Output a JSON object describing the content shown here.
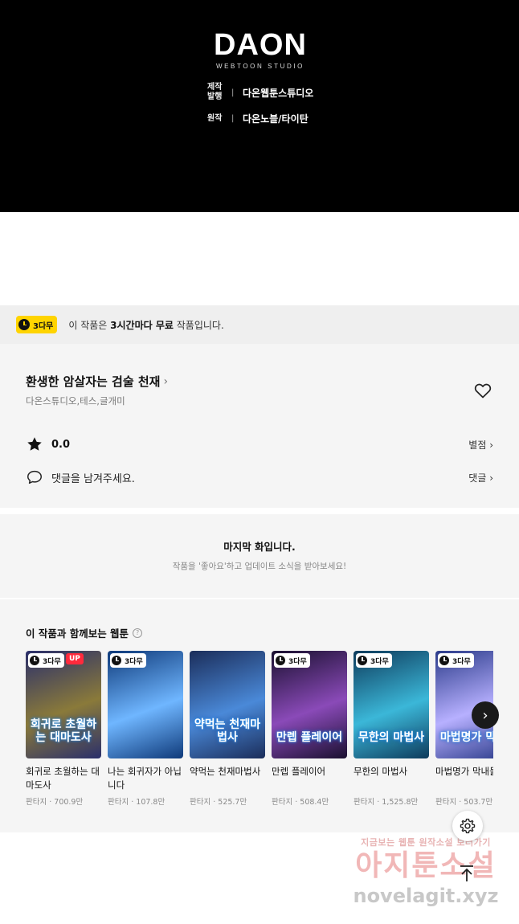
{
  "banner": {
    "logo_main": "DAON",
    "logo_sub": "WEBTOON STUDIO",
    "credits": [
      {
        "role": "제작 발행",
        "name": "다온웹툰스튜디오"
      },
      {
        "role": "원작",
        "name": "다온노블/타이탄"
      }
    ]
  },
  "free_notice": {
    "badge": "3다무",
    "text_prefix": "이 작품은 ",
    "text_bold": "3시간마다 무료",
    "text_suffix": " 작품입니다."
  },
  "work": {
    "title": "환생한 암살자는 검술 천재",
    "title_chevron": "›",
    "authors": "다온스튜디오,테스,글개미",
    "rating": "0.0",
    "rating_link": "별점 ›",
    "comment_placeholder": "댓글을 남겨주세요.",
    "comment_link": "댓글 ›"
  },
  "last_episode": {
    "title": "마지막 화입니다.",
    "subtitle": "작품을 '좋아요'하고 업데이트 소식을 받아보세요!"
  },
  "recommendations": {
    "heading": "이 작품과 함께보는 웹툰",
    "help": "?",
    "items": [
      {
        "badge": "3다무",
        "up": "UP",
        "thumb_text": "회귀로 초월하는 대마도사",
        "name": "회귀로 초월하는 대마도사",
        "meta": "판타지 · 700.9만",
        "c1": "#2a2f6b",
        "c2": "#8a7a3a"
      },
      {
        "badge": "3다무",
        "up": "",
        "thumb_text": "",
        "name": "나는 회귀자가 아닙니다",
        "meta": "판타지 · 107.8만",
        "c1": "#0f3a7a",
        "c2": "#6fb6ff"
      },
      {
        "badge": "",
        "up": "",
        "thumb_text": "약먹는 천재마법사",
        "name": "약먹는 천재마법사",
        "meta": "판타지 · 525.7만",
        "c1": "#1b2d5a",
        "c2": "#4a89d8"
      },
      {
        "badge": "3다무",
        "up": "",
        "thumb_text": "만렙 플레이어",
        "name": "만렙 플레이어",
        "meta": "판타지 · 508.4만",
        "c1": "#1a1030",
        "c2": "#8a4ab8"
      },
      {
        "badge": "3다무",
        "up": "",
        "thumb_text": "무한의 마법사",
        "name": "무한의 마법사",
        "meta": "판타지 · 1,525.8만",
        "c1": "#0e3b5c",
        "c2": "#3bb7d8"
      },
      {
        "badge": "3다무",
        "up": "",
        "thumb_text": "마법명가 막내",
        "name": "마법명가 막내들",
        "meta": "판타지 · 503.7만",
        "c1": "#2b3b8a",
        "c2": "#b7b0ff"
      }
    ],
    "next": "›"
  },
  "watermark": {
    "line1": "지금보는 웹툰 원작소설 보러가기",
    "line2": "아지툰소설",
    "line3": "novelagit.xyz"
  }
}
